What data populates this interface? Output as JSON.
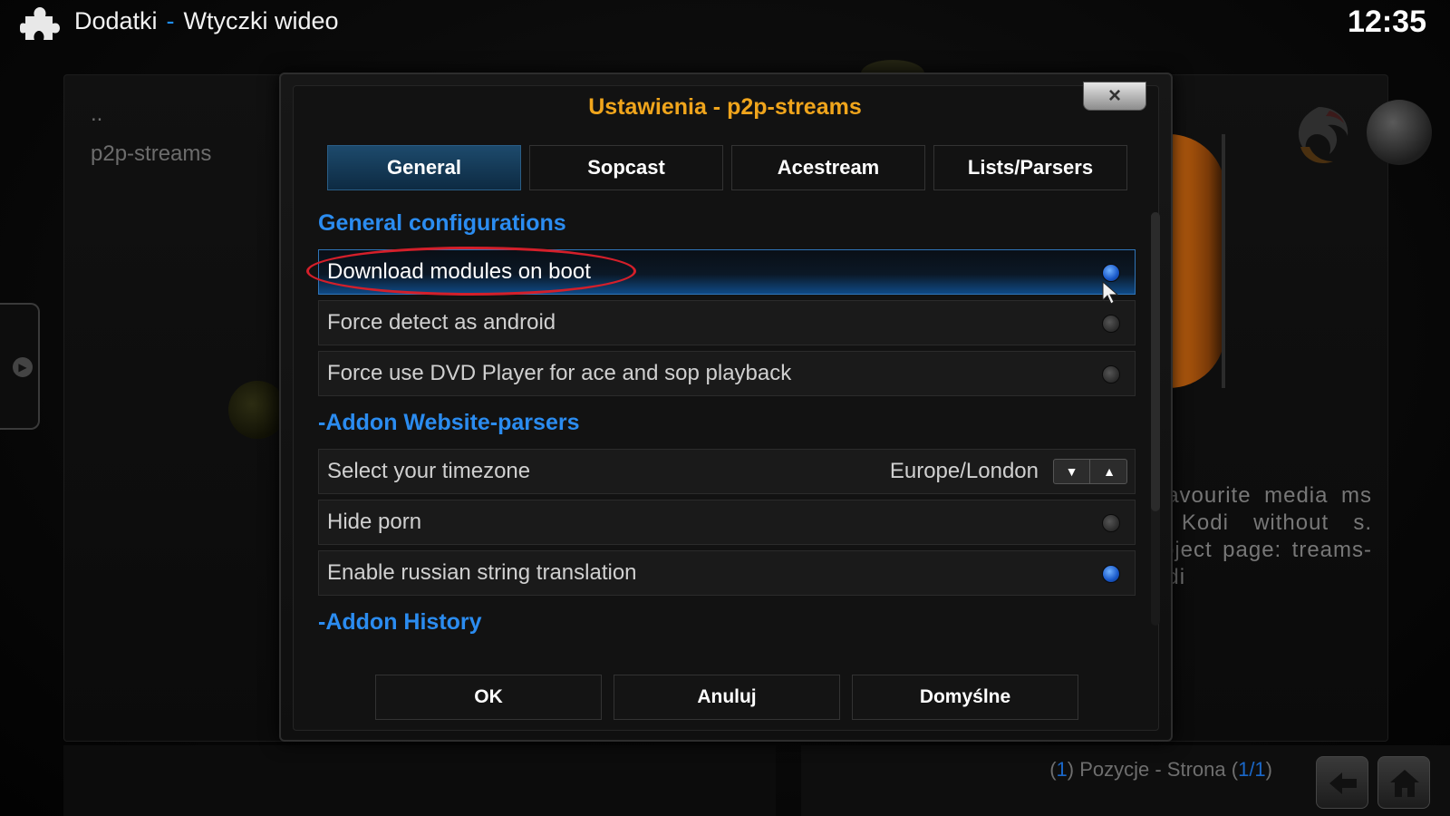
{
  "topbar": {
    "section": "Dodatki",
    "separator": "-",
    "subsection": "Wtyczki wideo",
    "clock": "12:35"
  },
  "background": {
    "list_items": [
      "..",
      "p2p-streams"
    ],
    "description": "Watch your favourite media streams in Kodi without ads. Project page: p2p-streams-Kodi",
    "description_visible": "r favourite media ms in Kodi without s. Project page: treams-Kodi",
    "pager": {
      "count": "1",
      "text_mid": " Pozycje - Strona ",
      "pages": "1/1"
    }
  },
  "dialog": {
    "title": "Ustawienia - p2p-streams",
    "close_label": "×",
    "tabs": [
      {
        "label": "General",
        "active": true
      },
      {
        "label": "Sopcast",
        "active": false
      },
      {
        "label": "Acestream",
        "active": false
      },
      {
        "label": "Lists/Parsers",
        "active": false
      }
    ],
    "sections": [
      {
        "title": "General configurations"
      },
      {
        "title": "-Addon Website-parsers"
      },
      {
        "title": "-Addon History"
      }
    ],
    "settings": [
      {
        "label": "Download modules on boot",
        "enabled": true,
        "focused": true
      },
      {
        "label": "Force detect as android",
        "enabled": false
      },
      {
        "label": "Force use DVD Player for ace and sop playback",
        "enabled": false
      },
      {
        "label": "Select your timezone",
        "value": "Europe/London"
      },
      {
        "label": "Hide porn",
        "enabled": false
      },
      {
        "label": "Enable russian string translation",
        "enabled": true
      }
    ],
    "buttons": {
      "ok": "OK",
      "cancel": "Anuluj",
      "defaults": "Domyślne"
    }
  },
  "colors": {
    "accent_blue": "#2b8cf0",
    "title_orange": "#f0a51c",
    "annotation_red": "#d41f2a"
  }
}
